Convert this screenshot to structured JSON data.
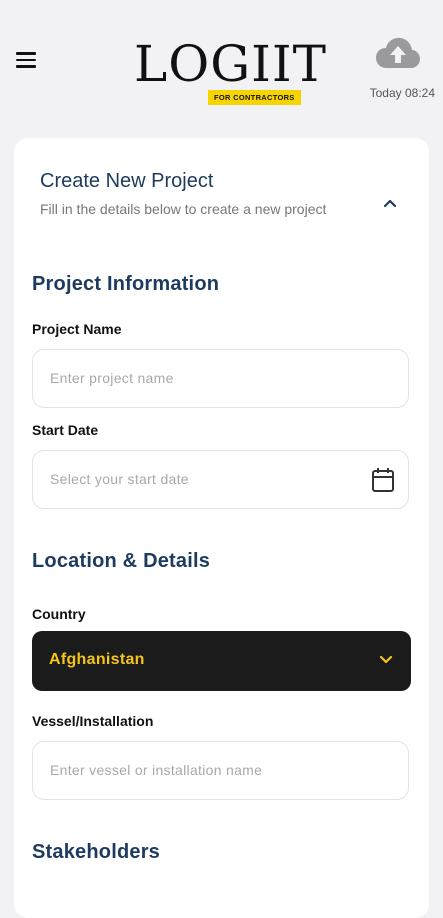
{
  "header": {
    "logo_text": "LOGIIT",
    "logo_badge": "FOR CONTRACTORS",
    "menu_icon": "hamburger-menu-icon",
    "sync_icon": "cloud-upload-icon",
    "sync_time": "Today 08:24"
  },
  "card": {
    "title": "Create New Project",
    "subtitle": "Fill in the details below to create a new project",
    "collapse_icon": "chevron-up-icon"
  },
  "project_info": {
    "section_title": "Project Information",
    "project_name_label": "Project Name",
    "project_name_placeholder": "Enter project name",
    "start_date_label": "Start Date",
    "start_date_placeholder": "Select your start date",
    "calendar_icon": "calendar-icon"
  },
  "location": {
    "section_title": "Location & Details",
    "country_label": "Country",
    "country_value": "Afghanistan",
    "vessel_label": "Vessel/Installation",
    "vessel_placeholder": "Enter vessel or installation name"
  },
  "stakeholders": {
    "section_title": "Stakeholders"
  },
  "colors": {
    "heading": "#1d3a5f",
    "accent_yellow": "#f5c518",
    "dark_select": "#1b1b1b",
    "background": "#f2f2f4"
  }
}
